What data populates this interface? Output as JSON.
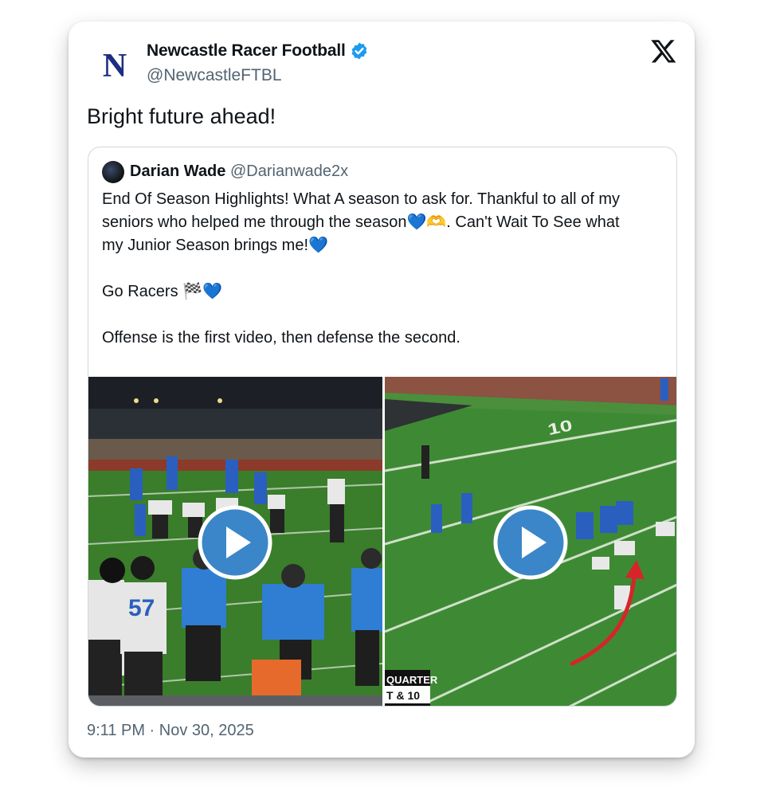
{
  "tweet": {
    "author_name": "Newcastle Racer Football",
    "author_handle": "@NewcastleFTBL",
    "logo_letter": "N",
    "text": "Bright future ahead!",
    "timestamp": "9:11 PM · Nov 30, 2025",
    "brand_icon": "x-logo-icon",
    "verified_icon": "verified-badge-icon"
  },
  "quoted_tweet": {
    "author_name": "Darian Wade",
    "author_handle": "@Darianwade2x",
    "lines": [
      "End Of Season Highlights! What A season to ask for. Thankful to all of my",
      "seniors who helped me through the season💙🫶. Can't Wait To See what",
      "my Junior Season brings me!💙",
      "Go Racers 🏁💙",
      "Offense is the first video, then defense the second."
    ]
  },
  "media": {
    "video1": {
      "icon": "play-button-icon",
      "subject": "sideline view of offense"
    },
    "video2": {
      "icon": "play-button-icon",
      "subject": "field view of defense",
      "scoreboard_line1": "QUARTER",
      "scoreboard_line2": "T & 10",
      "yard_marker": "10"
    }
  },
  "colors": {
    "verified_blue": "#1d9bf0",
    "play_blue": "#3b86c8",
    "logo_navy": "#1d2d84",
    "handle_gray": "#536471",
    "arrow_red": "#d7242a"
  }
}
